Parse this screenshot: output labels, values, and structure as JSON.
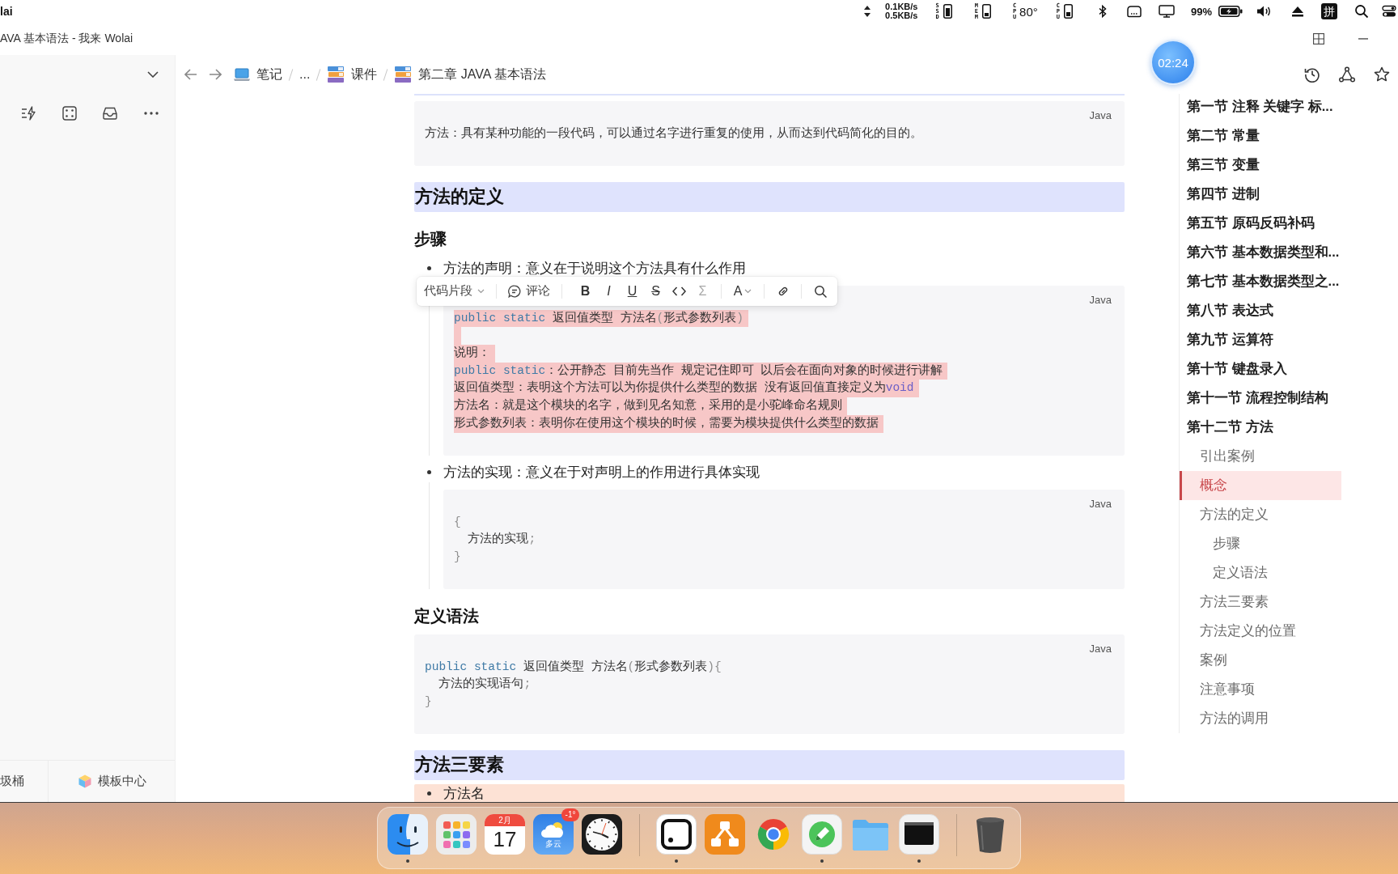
{
  "menu_bar": {
    "app_name": "lai",
    "net_speed": {
      "up": "0.1KB/s",
      "down": "0.5KB/s"
    },
    "ssd_label": "SSD",
    "mem_label": "MEM",
    "cpu_temp": {
      "label": "CPU",
      "reading": "80°"
    },
    "cpu_label": "CPU",
    "battery_reading": "99%",
    "input_method": "拼"
  },
  "window": {
    "title": "AVA 基本语法 - 我来 Wolai"
  },
  "sidebar": {
    "trash_label": "圾桶",
    "templates_label": "模板中心"
  },
  "breadcrumb": [
    {
      "kind": "notebook",
      "label": "笔记"
    },
    {
      "kind": "more",
      "label": "..."
    },
    {
      "kind": "book",
      "label": "课件"
    },
    {
      "kind": "book",
      "label": "第二章 JAVA 基本语法"
    }
  ],
  "timer": {
    "reading": "02:24"
  },
  "document": {
    "blocks": [
      {
        "kind": "code",
        "language": "Java",
        "selected": false,
        "lines": [
          {
            "kind": "text",
            "parts": [
              {
                "kind": "plain",
                "text": "方法：具有某种功能的一段代码，可以通过名字进行重复的使用，从而达到代码简化的目的。"
              }
            ]
          }
        ]
      },
      {
        "kind": "heading2",
        "text": "方法的定义"
      },
      {
        "kind": "heading3",
        "text": "步骤"
      },
      {
        "kind": "bullet",
        "text": "方法的声明：意义在于说明这个方法具有什么作用",
        "children": [
          {
            "kind": "code",
            "language": "Java",
            "selected": true,
            "selection_toolbar": {
              "block_type": "代码片段",
              "comment": "评论",
              "groups": [
                [
                  {
                    "kind": "bold",
                    "label": "B",
                    "disabled": false
                  },
                  {
                    "kind": "italic",
                    "label": "I",
                    "disabled": false
                  },
                  {
                    "kind": "underline",
                    "label": "U",
                    "disabled": false
                  },
                  {
                    "kind": "strike",
                    "label": "S",
                    "disabled": false
                  },
                  {
                    "kind": "code",
                    "disabled": false
                  },
                  {
                    "kind": "formula",
                    "label": "Σ",
                    "disabled": true
                  }
                ],
                [
                  {
                    "kind": "color",
                    "label": "A",
                    "disabled": false
                  }
                ],
                [
                  {
                    "kind": "link",
                    "disabled": false
                  }
                ],
                [
                  {
                    "kind": "search",
                    "disabled": false
                  }
                ]
              ]
            },
            "lines": [
              {
                "kind": "text",
                "parts": [
                  {
                    "kind": "keyword",
                    "text": "public static"
                  },
                  {
                    "kind": "plain",
                    "text": " 返回值类型 方法名"
                  },
                  {
                    "kind": "punct",
                    "text": "("
                  },
                  {
                    "kind": "plain",
                    "text": "形式参数列表"
                  },
                  {
                    "kind": "punct",
                    "text": ")"
                  }
                ]
              },
              {
                "kind": "blank"
              },
              {
                "kind": "text",
                "parts": [
                  {
                    "kind": "plain",
                    "text": "说明："
                  }
                ]
              },
              {
                "kind": "text",
                "parts": [
                  {
                    "kind": "keyword",
                    "text": "public static"
                  },
                  {
                    "kind": "plain",
                    "text": "：公开静态 目前先当作 规定记住即可 以后会在面向对象的时候进行讲解"
                  }
                ]
              },
              {
                "kind": "text",
                "parts": [
                  {
                    "kind": "plain",
                    "text": "返回值类型：表明这个方法可以为你提供什么类型的数据 没有返回值直接定义为"
                  },
                  {
                    "kind": "type",
                    "text": "void"
                  }
                ]
              },
              {
                "kind": "text",
                "parts": [
                  {
                    "kind": "plain",
                    "text": "方法名：就是这个模块的名字，做到见名知意，采用的是小驼峰命名规则"
                  }
                ]
              },
              {
                "kind": "text",
                "parts": [
                  {
                    "kind": "plain",
                    "text": "形式参数列表：表明你在使用这个模块的时候，需要为模块提供什么类型的数据"
                  }
                ]
              }
            ]
          }
        ]
      },
      {
        "kind": "bullet",
        "text": "方法的实现：意义在于对声明上的作用进行具体实现",
        "children": [
          {
            "kind": "code",
            "language": "Java",
            "selected": false,
            "lines": [
              {
                "kind": "text",
                "parts": [
                  {
                    "kind": "punct",
                    "text": "{"
                  }
                ]
              },
              {
                "kind": "text",
                "parts": [
                  {
                    "kind": "plain",
                    "text": "  方法的实现"
                  },
                  {
                    "kind": "punct",
                    "text": ";"
                  }
                ]
              },
              {
                "kind": "text",
                "parts": [
                  {
                    "kind": "punct",
                    "text": "}"
                  }
                ]
              }
            ]
          }
        ]
      },
      {
        "kind": "heading3",
        "text": "定义语法"
      },
      {
        "kind": "code",
        "language": "Java",
        "selected": false,
        "lines": [
          {
            "kind": "text",
            "parts": [
              {
                "kind": "keyword",
                "text": "public static"
              },
              {
                "kind": "plain",
                "text": " 返回值类型 方法名"
              },
              {
                "kind": "punct",
                "text": "("
              },
              {
                "kind": "plain",
                "text": "形式参数列表"
              },
              {
                "kind": "punct",
                "text": "){"
              }
            ]
          },
          {
            "kind": "text",
            "parts": [
              {
                "kind": "plain",
                "text": "  方法的实现语句"
              },
              {
                "kind": "punct",
                "text": ";"
              }
            ]
          },
          {
            "kind": "text",
            "parts": [
              {
                "kind": "punct",
                "text": "}"
              }
            ]
          }
        ]
      },
      {
        "kind": "heading2",
        "text": "方法三要素"
      },
      {
        "kind": "bullet",
        "text": "方法名",
        "color": "#fde2d5"
      }
    ]
  },
  "outline": {
    "items": [
      {
        "label": "第一节 注释 关键字 标...",
        "selected": false
      },
      {
        "label": "第二节 常量",
        "selected": false
      },
      {
        "label": "第三节 变量",
        "selected": false
      },
      {
        "label": "第四节 进制",
        "selected": false
      },
      {
        "label": "第五节 原码反码补码",
        "selected": false
      },
      {
        "label": "第六节 基本数据类型和...",
        "selected": false
      },
      {
        "label": "第七节 基本数据类型之...",
        "selected": false
      },
      {
        "label": "第八节 表达式",
        "selected": false
      },
      {
        "label": "第九节 运算符",
        "selected": false
      },
      {
        "label": "第十节 键盘录入",
        "selected": false
      },
      {
        "label": "第十一节 流程控制结构",
        "selected": false
      },
      {
        "label": "第十二节 方法",
        "selected": false,
        "children": [
          {
            "label": "引出案例",
            "selected": false
          },
          {
            "label": "概念",
            "selected": true
          },
          {
            "label": "方法的定义",
            "selected": false,
            "children": [
              {
                "label": "步骤",
                "selected": false
              },
              {
                "label": "定义语法",
                "selected": false
              }
            ]
          },
          {
            "label": "方法三要素",
            "selected": false
          },
          {
            "label": "方法定义的位置",
            "selected": false
          },
          {
            "label": "案例",
            "selected": false
          },
          {
            "label": "注意事项",
            "selected": false
          },
          {
            "label": "方法的调用",
            "selected": false
          }
        ]
      }
    ]
  },
  "dock": {
    "groups": [
      [
        {
          "kind": "face",
          "running": true
        },
        {
          "kind": "grid",
          "running": false
        },
        {
          "kind": "calendar",
          "running": false,
          "month": "2月",
          "day": "17"
        },
        {
          "kind": "weather",
          "running": false,
          "badge": "-1°",
          "caption": "多云"
        },
        {
          "kind": "clock",
          "running": false
        }
      ],
      [
        {
          "kind": "dot-square",
          "running": true
        },
        {
          "kind": "diagram",
          "running": false
        },
        {
          "kind": "browser",
          "running": false
        },
        {
          "kind": "pencil",
          "running": true
        },
        {
          "kind": "folder",
          "running": false
        },
        {
          "kind": "screen",
          "running": true
        }
      ],
      [
        {
          "kind": "trash",
          "running": false
        }
      ]
    ]
  }
}
